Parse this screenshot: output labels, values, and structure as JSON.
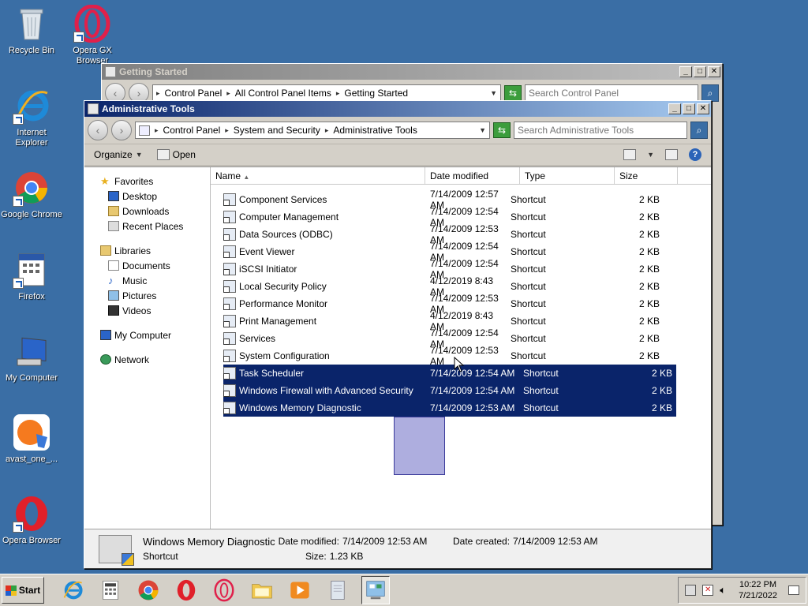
{
  "desktop": {
    "icons": [
      {
        "label": "Recycle Bin"
      },
      {
        "label": "Opera GX Browser"
      },
      {
        "label": "Internet Explorer"
      },
      {
        "label": "Google Chrome"
      },
      {
        "label": "Firefox"
      },
      {
        "label": "My Computer"
      },
      {
        "label": "avast_one_..."
      },
      {
        "label": "Opera Browser"
      }
    ]
  },
  "back_window": {
    "title": "Getting Started",
    "breadcrumbs": [
      "Control Panel",
      "All Control Panel Items",
      "Getting Started"
    ],
    "search_placeholder": "Search Control Panel"
  },
  "window": {
    "title": "Administrative Tools",
    "breadcrumbs": [
      "Control Panel",
      "System and Security",
      "Administrative Tools"
    ],
    "search_placeholder": "Search Administrative Tools",
    "toolbar": {
      "organize": "Organize",
      "open": "Open"
    },
    "nav": {
      "favorites": {
        "label": "Favorites",
        "items": [
          "Desktop",
          "Downloads",
          "Recent Places"
        ]
      },
      "libraries": {
        "label": "Libraries",
        "items": [
          "Documents",
          "Music",
          "Pictures",
          "Videos"
        ]
      },
      "computer": "My Computer",
      "network": "Network"
    },
    "columns": [
      "Name",
      "Date modified",
      "Type",
      "Size"
    ],
    "files": [
      {
        "name": "Component Services",
        "date": "7/14/2009 12:57 AM",
        "type": "Shortcut",
        "size": "2 KB",
        "selected": false
      },
      {
        "name": "Computer Management",
        "date": "7/14/2009 12:54 AM",
        "type": "Shortcut",
        "size": "2 KB",
        "selected": false
      },
      {
        "name": "Data Sources (ODBC)",
        "date": "7/14/2009 12:53 AM",
        "type": "Shortcut",
        "size": "2 KB",
        "selected": false
      },
      {
        "name": "Event Viewer",
        "date": "7/14/2009 12:54 AM",
        "type": "Shortcut",
        "size": "2 KB",
        "selected": false
      },
      {
        "name": "iSCSI Initiator",
        "date": "7/14/2009 12:54 AM",
        "type": "Shortcut",
        "size": "2 KB",
        "selected": false
      },
      {
        "name": "Local Security Policy",
        "date": "4/12/2019 8:43 AM",
        "type": "Shortcut",
        "size": "2 KB",
        "selected": false
      },
      {
        "name": "Performance Monitor",
        "date": "7/14/2009 12:53 AM",
        "type": "Shortcut",
        "size": "2 KB",
        "selected": false
      },
      {
        "name": "Print Management",
        "date": "4/12/2019 8:43 AM",
        "type": "Shortcut",
        "size": "2 KB",
        "selected": false
      },
      {
        "name": "Services",
        "date": "7/14/2009 12:54 AM",
        "type": "Shortcut",
        "size": "2 KB",
        "selected": false
      },
      {
        "name": "System Configuration",
        "date": "7/14/2009 12:53 AM",
        "type": "Shortcut",
        "size": "2 KB",
        "selected": false
      },
      {
        "name": "Task Scheduler",
        "date": "7/14/2009 12:54 AM",
        "type": "Shortcut",
        "size": "2 KB",
        "selected": true
      },
      {
        "name": "Windows Firewall with Advanced Security",
        "date": "7/14/2009 12:54 AM",
        "type": "Shortcut",
        "size": "2 KB",
        "selected": true
      },
      {
        "name": "Windows Memory Diagnostic",
        "date": "7/14/2009 12:53 AM",
        "type": "Shortcut",
        "size": "2 KB",
        "selected": true
      }
    ],
    "details": {
      "name": "Windows Memory Diagnostic",
      "type": "Shortcut",
      "date_modified_label": "Date modified:",
      "date_modified": "7/14/2009 12:53 AM",
      "date_created_label": "Date created:",
      "date_created": "7/14/2009 12:53 AM",
      "size_label": "Size:",
      "size": "1.23 KB"
    }
  },
  "taskbar": {
    "start_label": "Start",
    "time": "10:22 PM",
    "date": "7/21/2022"
  },
  "colors": {
    "desktop": "#3a6ea5",
    "selection": "#0a246a",
    "title_active": "#0a246a"
  }
}
